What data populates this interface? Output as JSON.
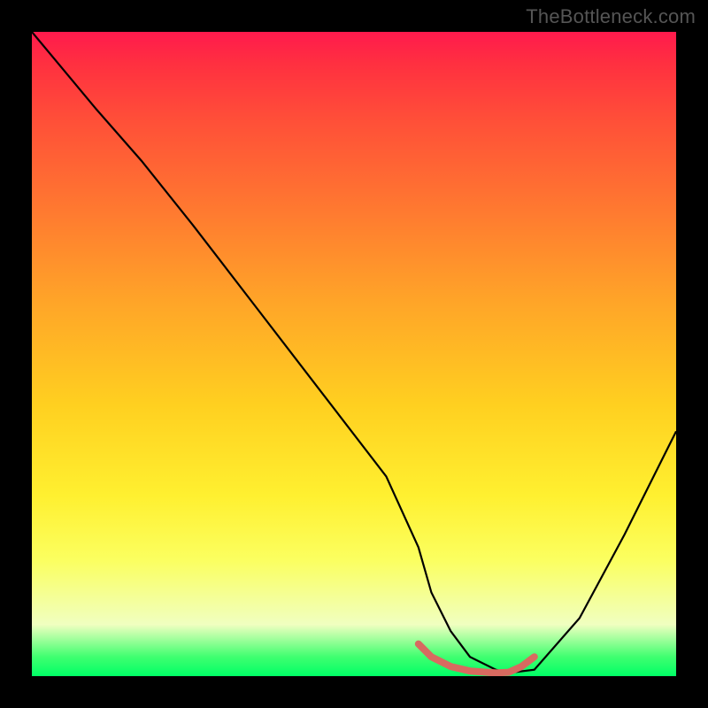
{
  "watermark": "TheBottleneck.com",
  "chart_data": {
    "type": "line",
    "title": "",
    "xlabel": "",
    "ylabel": "",
    "xlim": [
      0,
      100
    ],
    "ylim": [
      0,
      100
    ],
    "grid": false,
    "legend": false,
    "series": [
      {
        "name": "main-curve",
        "color": "#000000",
        "x": [
          0,
          5,
          10,
          17,
          25,
          35,
          45,
          55,
          60,
          62,
          65,
          68,
          72,
          74,
          78,
          85,
          92,
          100
        ],
        "y": [
          100,
          94,
          88,
          80,
          70,
          57,
          44,
          31,
          20,
          13,
          7,
          3,
          1,
          0.5,
          1,
          9,
          22,
          38
        ]
      },
      {
        "name": "highlight-segment",
        "color": "#d86a60",
        "x": [
          60,
          62,
          65,
          68,
          72,
          74,
          76,
          78
        ],
        "y": [
          5,
          3,
          1.5,
          0.8,
          0.5,
          0.6,
          1.5,
          3
        ]
      }
    ],
    "annotations": []
  }
}
